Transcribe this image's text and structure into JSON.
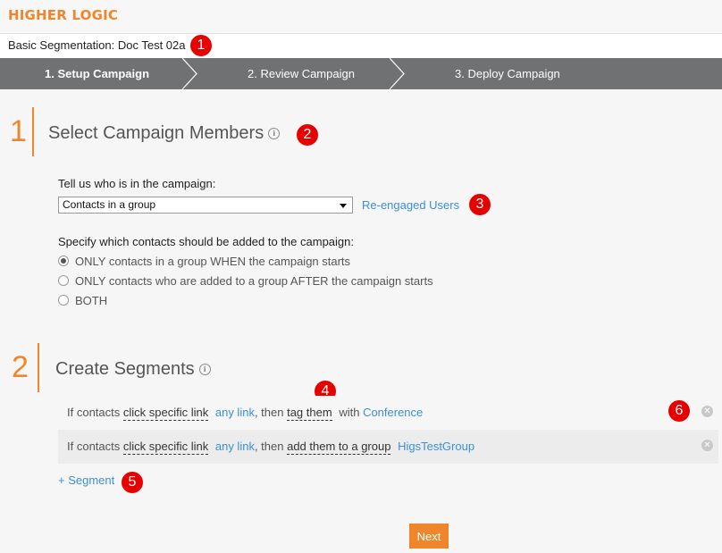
{
  "brand": {
    "logo": "HIGHER LOGIC"
  },
  "campaign": {
    "title": "Basic Segmentation: Doc Test 02a"
  },
  "steps": [
    {
      "label": "1. Setup Campaign",
      "active": true
    },
    {
      "label": "2. Review Campaign",
      "active": false
    },
    {
      "label": "3. Deploy Campaign",
      "active": false
    }
  ],
  "section1": {
    "number": "1",
    "heading": "Select Campaign Members",
    "who_label": "Tell us who is in the campaign:",
    "select_value": "Contacts in a group",
    "group_link": "Re-engaged Users",
    "specify_label": "Specify which contacts should be added to the campaign:",
    "radios": [
      {
        "label": "ONLY contacts in a group WHEN the campaign starts",
        "checked": true
      },
      {
        "label": "ONLY contacts who are added to a group AFTER the campaign starts",
        "checked": false
      },
      {
        "label": "BOTH",
        "checked": false
      }
    ]
  },
  "section2": {
    "number": "2",
    "heading": "Create Segments",
    "segments": [
      {
        "prefix": "If contacts",
        "condition": "click specific link",
        "link": "any link",
        "then": ", then",
        "action": "tag them",
        "connector": "with",
        "target": "Conference"
      },
      {
        "prefix": "If contacts",
        "condition": "click specific link",
        "link": "any link",
        "then": ", then",
        "action": "add them to a group",
        "connector": "",
        "target": "HigsTestGroup"
      }
    ],
    "add_segment": "+ Segment"
  },
  "footer": {
    "next": "Next"
  },
  "callouts": [
    "1",
    "2",
    "3",
    "4",
    "5",
    "6"
  ],
  "colors": {
    "accent": "#f0862b",
    "link": "#3b8fd9",
    "callout": "#e60000",
    "stepbar": "#6f7173"
  }
}
